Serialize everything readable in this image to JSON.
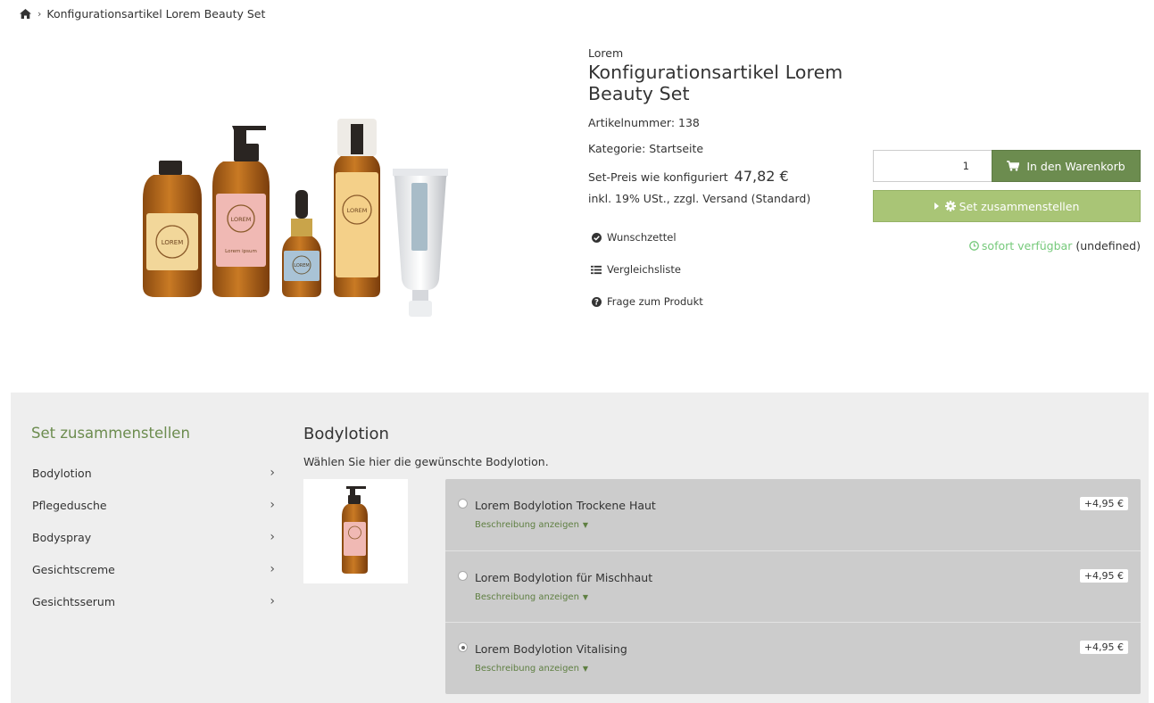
{
  "breadcrumb": {
    "home_icon": "home-icon",
    "separator": "›",
    "current": "Konfigurationsartikel Lorem Beauty Set"
  },
  "product": {
    "brand": "Lorem",
    "title": "Konfigurationsartikel Lorem Beauty Set",
    "article_number": "Artikelnummer: 138",
    "category": "Kategorie: Startseite",
    "price_label": "Set-Preis wie konfiguriert",
    "price": "47,82 €",
    "tax_info": "inkl. 19% USt., zzgl. Versand (Standard)",
    "image_labels": {
      "brand_mark": "LOREM",
      "sub_label": "Lorem ipsum"
    }
  },
  "actions": [
    {
      "label": "Wunschzettel",
      "icon": "check-circle-icon"
    },
    {
      "label": "Vergleichsliste",
      "icon": "list-icon"
    },
    {
      "label": "Frage zum Produkt",
      "icon": "question-circle-icon"
    }
  ],
  "buy": {
    "quantity": "1",
    "cart_label": "In den Warenkorb",
    "set_label": "Set zusammenstellen",
    "availability": "sofort verfügbar",
    "availability_extra": "(undefined)"
  },
  "configurator": {
    "sidebar_title": "Set zusammenstellen",
    "sidebar_items": [
      "Bodylotion",
      "Pflegedusche",
      "Bodyspray",
      "Gesichtscreme",
      "Gesichtsserum"
    ],
    "section_title": "Bodylotion",
    "section_subtitle": "Wählen Sie hier die gewünschte Bodylotion.",
    "options": [
      {
        "name": "Lorem Bodylotion Trockene Haut",
        "desc": "Beschreibung anzeigen",
        "price": "+4,95 €",
        "selected": false
      },
      {
        "name": "Lorem Bodylotion für Mischhaut",
        "desc": "Beschreibung anzeigen",
        "price": "+4,95 €",
        "selected": false
      },
      {
        "name": "Lorem Bodylotion Vitalising",
        "desc": "Beschreibung anzeigen",
        "price": "+4,95 €",
        "selected": true
      }
    ]
  },
  "colors": {
    "primary_green": "#6c8c4f",
    "light_green": "#a9c576",
    "available_green": "#75c97a",
    "panel_bg": "#eeeeee",
    "options_bg": "#cccccc"
  }
}
